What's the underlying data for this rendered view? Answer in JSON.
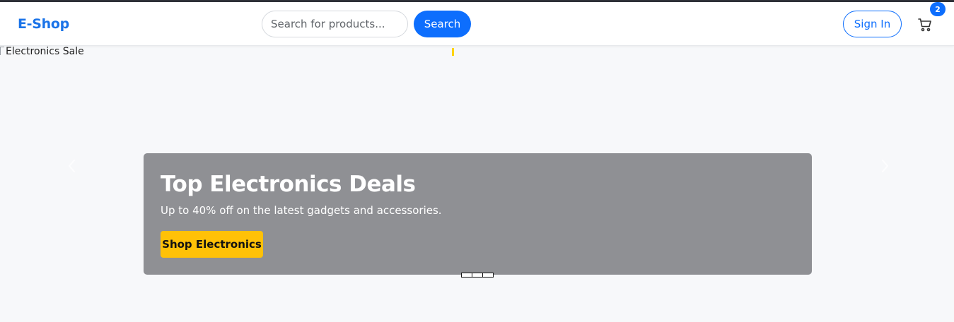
{
  "navbar": {
    "brand": "E-Shop",
    "search": {
      "placeholder": "Search for products...",
      "value": ""
    },
    "search_label": "Search",
    "signin_label": "Sign In",
    "cart_count": "2"
  },
  "hero": {
    "image_alt": "Electronics Sale",
    "title": "Top Electronics Deals",
    "subtitle": "Up to 40% off on the latest gadgets and accessories.",
    "cta_label": "Shop Electronics",
    "slide_count": 3,
    "active_slide": 1
  },
  "colors": {
    "brand": "#1a73e8",
    "primary": "#0d6efd",
    "cta": "#ffc107",
    "caption_bg": "#8f9094",
    "page_bg": "#f7f8fa"
  },
  "icons": {
    "cart": "cart-icon",
    "prev": "chevron-left-icon",
    "next": "chevron-right-icon",
    "broken_image": "broken-image-icon"
  }
}
